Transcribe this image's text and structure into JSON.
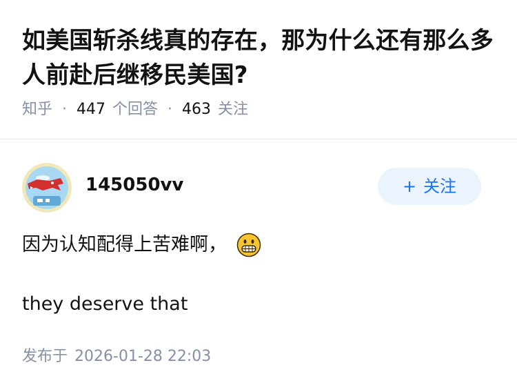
{
  "question": {
    "title": "如美国斩杀线真的存在，那为什么还有那么多人前赴后继移民美国?",
    "source": "知乎",
    "answer_count": "447",
    "answer_label": "个回答",
    "follower_count": "463",
    "follower_label": "关注"
  },
  "answer": {
    "author": {
      "name": "145050vv",
      "avatar": "avatar-shark-illustration"
    },
    "follow_label": "关注",
    "follow_icon": "plus-icon",
    "content": {
      "line1": "因为认知配得上苦难啊，",
      "emoji": "grinning-face-emoji",
      "line2": "they deserve that"
    },
    "publish_label": "发布于",
    "publish_time": "2026-01-28 22:03"
  },
  "colors": {
    "accent": "#1772f6",
    "button_bg": "#ebf3fc",
    "meta_text": "#8590a6",
    "text": "#121212"
  }
}
